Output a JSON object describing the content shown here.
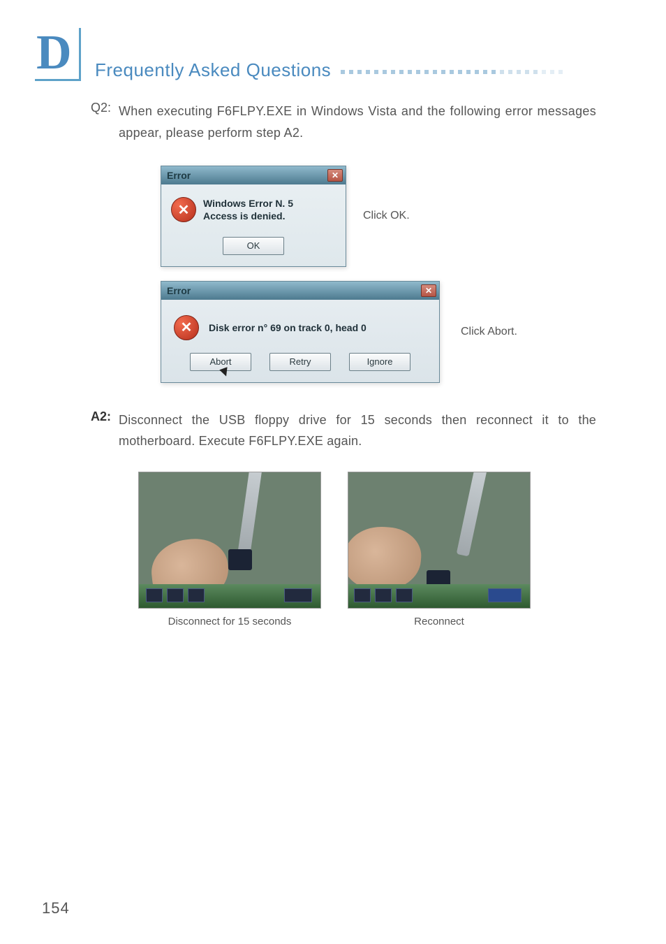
{
  "appendix_letter": "D",
  "section_title": "Frequently Asked Questions",
  "q2": {
    "label": "Q2:",
    "text": "When executing F6FLPY.EXE in Windows Vista and the following error messages appear, please perform step A2."
  },
  "dialog1": {
    "title": "Error",
    "message_line1": "Windows Error N. 5",
    "message_line2": "Access is denied.",
    "ok_label": "OK",
    "caption": "Click OK."
  },
  "dialog2": {
    "title": "Error",
    "message": "Disk error n° 69 on track 0, head 0",
    "abort_label": "Abort",
    "retry_label": "Retry",
    "ignore_label": "Ignore",
    "caption": "Click Abort."
  },
  "a2": {
    "label": "A2:",
    "text": "Disconnect the USB floppy drive for 15 seconds then reconnect it to the motherboard. Execute F6FLPY.EXE again."
  },
  "photo_captions": {
    "left": "Disconnect for 15 seconds",
    "right": "Reconnect"
  },
  "page_number": "154"
}
